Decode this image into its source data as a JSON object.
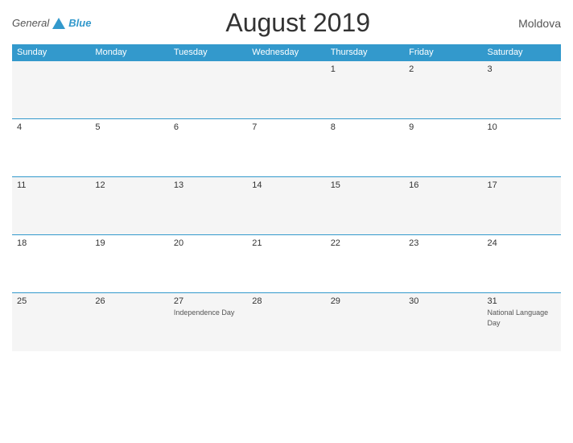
{
  "header": {
    "logo_general": "General",
    "logo_blue": "Blue",
    "title": "August 2019",
    "country": "Moldova"
  },
  "calendar": {
    "days_of_week": [
      "Sunday",
      "Monday",
      "Tuesday",
      "Wednesday",
      "Thursday",
      "Friday",
      "Saturday"
    ],
    "weeks": [
      [
        {
          "day": "",
          "holiday": ""
        },
        {
          "day": "",
          "holiday": ""
        },
        {
          "day": "",
          "holiday": ""
        },
        {
          "day": "",
          "holiday": ""
        },
        {
          "day": "1",
          "holiday": ""
        },
        {
          "day": "2",
          "holiday": ""
        },
        {
          "day": "3",
          "holiday": ""
        }
      ],
      [
        {
          "day": "4",
          "holiday": ""
        },
        {
          "day": "5",
          "holiday": ""
        },
        {
          "day": "6",
          "holiday": ""
        },
        {
          "day": "7",
          "holiday": ""
        },
        {
          "day": "8",
          "holiday": ""
        },
        {
          "day": "9",
          "holiday": ""
        },
        {
          "day": "10",
          "holiday": ""
        }
      ],
      [
        {
          "day": "11",
          "holiday": ""
        },
        {
          "day": "12",
          "holiday": ""
        },
        {
          "day": "13",
          "holiday": ""
        },
        {
          "day": "14",
          "holiday": ""
        },
        {
          "day": "15",
          "holiday": ""
        },
        {
          "day": "16",
          "holiday": ""
        },
        {
          "day": "17",
          "holiday": ""
        }
      ],
      [
        {
          "day": "18",
          "holiday": ""
        },
        {
          "day": "19",
          "holiday": ""
        },
        {
          "day": "20",
          "holiday": ""
        },
        {
          "day": "21",
          "holiday": ""
        },
        {
          "day": "22",
          "holiday": ""
        },
        {
          "day": "23",
          "holiday": ""
        },
        {
          "day": "24",
          "holiday": ""
        }
      ],
      [
        {
          "day": "25",
          "holiday": ""
        },
        {
          "day": "26",
          "holiday": ""
        },
        {
          "day": "27",
          "holiday": "Independence Day"
        },
        {
          "day": "28",
          "holiday": ""
        },
        {
          "day": "29",
          "holiday": ""
        },
        {
          "day": "30",
          "holiday": ""
        },
        {
          "day": "31",
          "holiday": "National Language Day"
        }
      ]
    ]
  }
}
